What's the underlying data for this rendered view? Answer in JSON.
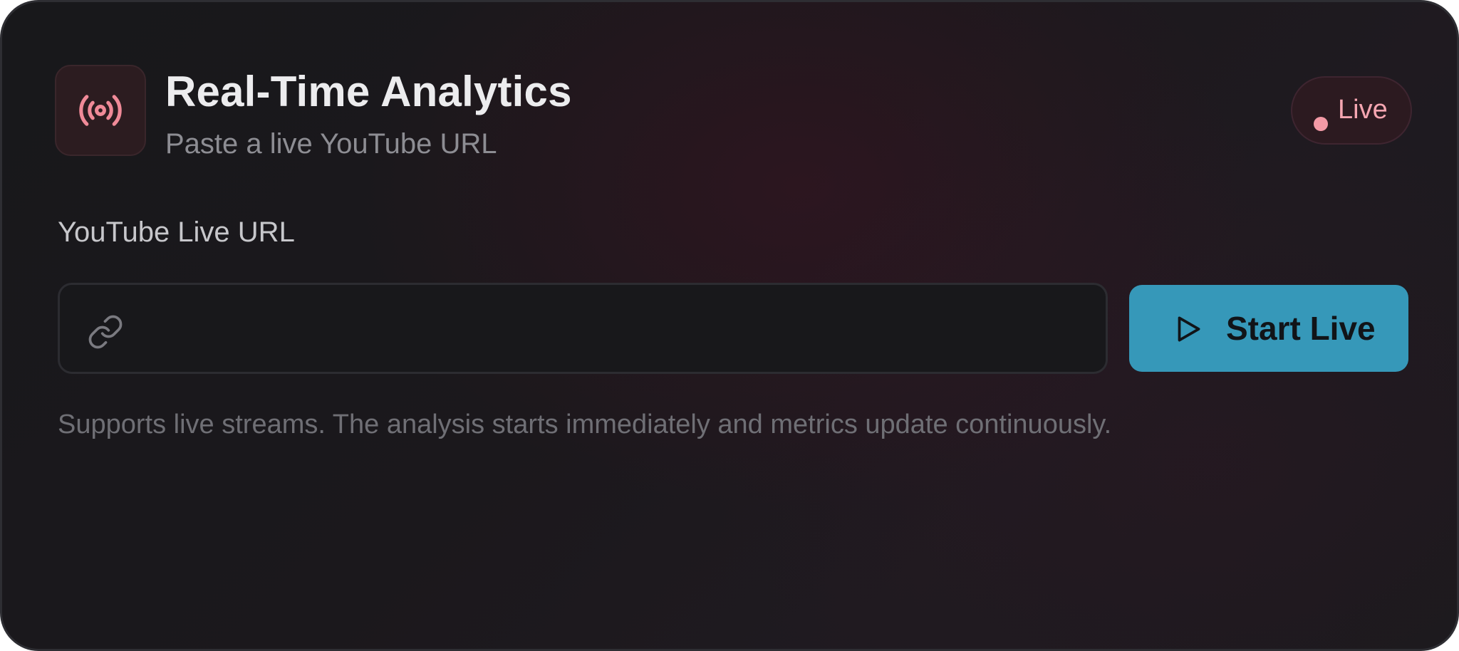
{
  "header": {
    "title": "Real-Time Analytics",
    "subtitle": "Paste a live YouTube URL",
    "icon": "broadcast-icon",
    "status_badge": {
      "label": "Live",
      "dot_color": "#f39aa6"
    }
  },
  "form": {
    "url_label": "YouTube Live URL",
    "url_input": {
      "value": "",
      "placeholder": "",
      "icon": "link-icon"
    },
    "start_button": {
      "label": "Start Live",
      "icon": "play-icon",
      "color": "#3698b9"
    },
    "helper_text": "Supports live streams. The analysis starts immediately and metrics update continuously."
  },
  "colors": {
    "accent": "#3698b9",
    "live": "#f5a6b1",
    "background": "#1b1a1e"
  }
}
